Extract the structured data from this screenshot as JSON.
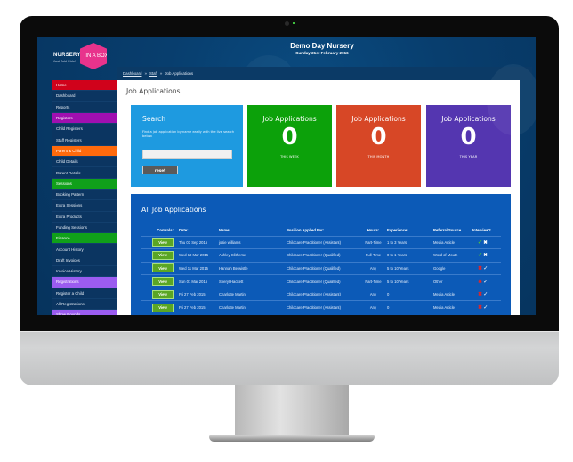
{
  "header": {
    "logo_word": "NURSERY",
    "logo_box": "IN A BOX",
    "logo_tagline": "Just Add Kids!",
    "title": "Demo Day Nursery",
    "date": "Sunday 21st February 2016"
  },
  "breadcrumb": [
    {
      "label": "Dashboard",
      "link": true
    },
    {
      "label": "Staff",
      "link": true
    },
    {
      "label": "Job Applications",
      "link": false
    }
  ],
  "breadcrumb_separator": "»",
  "sidebar": {
    "items": [
      {
        "label": "Home",
        "section": true,
        "color": "#d0021b"
      },
      {
        "label": "Dashboard"
      },
      {
        "label": "Reports"
      },
      {
        "label": "Registers",
        "section": true,
        "color": "#a00fb0"
      },
      {
        "label": "Child Registers"
      },
      {
        "label": "Staff Registers"
      },
      {
        "label": "Parent & Child",
        "section": true,
        "color": "#ff6a0c"
      },
      {
        "label": "Child Details"
      },
      {
        "label": "Parent Details"
      },
      {
        "label": "Sessions",
        "section": true,
        "color": "#10a01a"
      },
      {
        "label": "Booking Pattern"
      },
      {
        "label": "Extra Sessions"
      },
      {
        "label": "Extra Products"
      },
      {
        "label": "Funding Sessions"
      },
      {
        "label": "Finance",
        "section": true,
        "color": "#10a01a"
      },
      {
        "label": "Account History"
      },
      {
        "label": "Draft Invoices"
      },
      {
        "label": "Invoice History"
      },
      {
        "label": "Registrations",
        "section": true,
        "color": "#9b5cf0"
      },
      {
        "label": "Register a Child"
      },
      {
        "label": "All Registrations"
      },
      {
        "label": "Show Rounds",
        "section": true,
        "color": "#9b5cf0"
      }
    ]
  },
  "page": {
    "title": "Job Applications"
  },
  "search": {
    "heading": "Search",
    "description": "Find a job application by name easily with the live search below.",
    "input_value": "",
    "input_placeholder": "",
    "reset_label": "reset"
  },
  "stats": [
    {
      "heading": "Job Applications",
      "value": "0",
      "period": "THIS WEEK",
      "color": "#0ca10a"
    },
    {
      "heading": "Job Applications",
      "value": "0",
      "period": "THIS MONTH",
      "color": "#d74726"
    },
    {
      "heading": "Job Applications",
      "value": "0",
      "period": "THIS YEAR",
      "color": "#5436b0"
    }
  ],
  "applications": {
    "title": "All Job Applications",
    "columns": [
      "Controls:",
      "Date:",
      "Name:",
      "Position Applied For:",
      "Hours:",
      "Experience:",
      "Referral Source",
      "Interview?"
    ],
    "view_label": "View",
    "rows": [
      {
        "date": "Thu 03 Sep 2015",
        "name": "josie williams",
        "position": "Childcare Practitioner (Assistant)",
        "hours": "Part-Time",
        "experience": "1 to 3 Years",
        "referral": "Media Article",
        "interview": "yes"
      },
      {
        "date": "Wed 18 Mar 2015",
        "name": "Ashley Clitherse",
        "position": "Childcare Practitioner (Qualified)",
        "hours": "Full-Time",
        "experience": "0 to 1 Years",
        "referral": "Word of Mouth",
        "interview": "yes"
      },
      {
        "date": "Wed 11 Mar 2015",
        "name": "Hannah Betwistle",
        "position": "Childcare Practitioner (Qualified)",
        "hours": "Any",
        "experience": "5 to 10 Years",
        "referral": "Google",
        "interview": "no"
      },
      {
        "date": "Sun 01 Mar 2015",
        "name": "Sheryl Hackett",
        "position": "Childcare Practitioner (Qualified)",
        "hours": "Part-Time",
        "experience": "5 to 10 Years",
        "referral": "Other",
        "interview": "no"
      },
      {
        "date": "Fri 27 Feb 2015",
        "name": "Charlotte Martin",
        "position": "Childcare Practitioner (Assistant)",
        "hours": "Any",
        "experience": "0",
        "referral": "Media Article",
        "interview": "no"
      },
      {
        "date": "Fri 27 Feb 2015",
        "name": "Charlotte Martin",
        "position": "Childcare Practitioner (Assistant)",
        "hours": "Any",
        "experience": "0",
        "referral": "Media Article",
        "interview": "no"
      }
    ]
  },
  "icons": {
    "tick": "✔",
    "cross": "✖",
    "tick_light": "✓"
  }
}
